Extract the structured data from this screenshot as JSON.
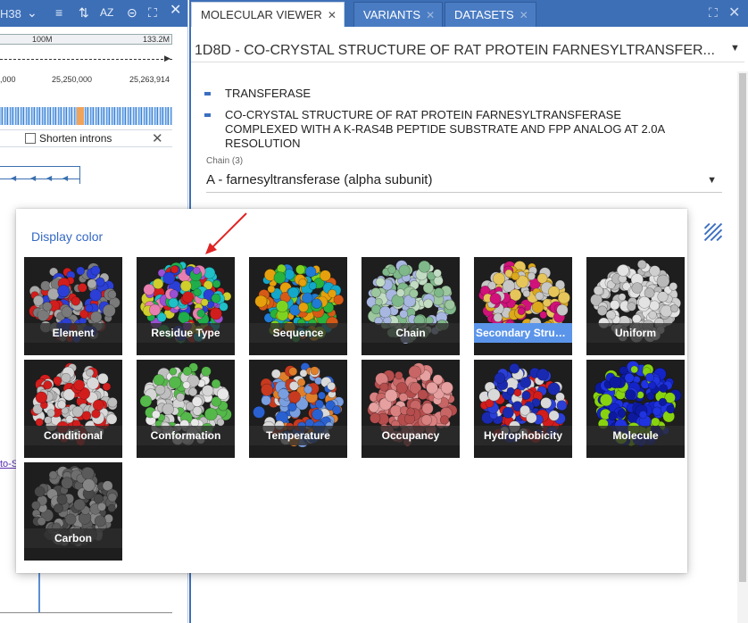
{
  "genome_panel": {
    "build": "H38",
    "ruler_left": "100M",
    "ruler_right": "133.2M",
    "coord_left": ",000",
    "coord_mid": "25,250,000",
    "coord_right": "25,263,914",
    "shorten_introns_label": "Shorten introns",
    "shorten_introns_checked": false,
    "truncated_link": "to-S"
  },
  "tabs": [
    {
      "label": "MOLECULAR VIEWER",
      "active": true
    },
    {
      "label": "VARIANTS",
      "active": false
    },
    {
      "label": "DATASETS",
      "active": false
    }
  ],
  "structure": {
    "title": "1D8D  - CO-CRYSTAL STRUCTURE OF RAT PROTEIN FARNESYLTRANSFER...",
    "keywords": [
      "TRANSFERASE",
      "CO-CRYSTAL STRUCTURE OF RAT PROTEIN FARNESYLTRANSFERASE",
      "COMPLEXED WITH A K-RAS4B PEPTIDE SUBSTRATE AND FPP ANALOG AT 2.0A",
      "RESOLUTION"
    ],
    "chain_label": "Chain (3)",
    "chain_value": "A - farnesyltransferase (alpha subunit)"
  },
  "display_color": {
    "heading": "Display color",
    "selected": "Secondary Structure",
    "options": [
      {
        "label": "Element",
        "palette": [
          "#7a7a7a",
          "#d21d1d",
          "#2b3fd6",
          "#a9a9a9"
        ]
      },
      {
        "label": "Residue Type",
        "palette": [
          "#d0ce2c",
          "#1fae4b",
          "#d21d1d",
          "#2b3fd6",
          "#9b4fd3",
          "#1fc0c8",
          "#e87fb0"
        ]
      },
      {
        "label": "Sequence",
        "palette": [
          "#28b33c",
          "#1f7bd6",
          "#e6a00d",
          "#d65a16",
          "#7ed321",
          "#13a7c9"
        ]
      },
      {
        "label": "Chain",
        "palette": [
          "#9dc79f",
          "#a8b7e0",
          "#7fb88a",
          "#c2dcc3"
        ]
      },
      {
        "label": "Secondary Structure",
        "palette": [
          "#dca81c",
          "#c7c7c7",
          "#d0127a",
          "#e6c55a"
        ]
      },
      {
        "label": "Uniform",
        "palette": [
          "#cfcfcf",
          "#b9b9b9",
          "#e3e3e3"
        ]
      },
      {
        "label": "Conditional",
        "palette": [
          "#d9d9d9",
          "#d21d1d",
          "#bdbdbd"
        ]
      },
      {
        "label": "Conformation",
        "palette": [
          "#d6d6d6",
          "#bfbfbf",
          "#e8e8e8",
          "#55b84a"
        ]
      },
      {
        "label": "Temperature",
        "palette": [
          "#c73a1f",
          "#2a61d1",
          "#e07f2a",
          "#d9d9d9",
          "#7a9fe0"
        ]
      },
      {
        "label": "Occupancy",
        "palette": [
          "#c86565",
          "#d98080",
          "#b54d4d",
          "#e6a0a0"
        ]
      },
      {
        "label": "Hydrophobicity",
        "palette": [
          "#2b3fd6",
          "#d21d1d",
          "#d9d9d9",
          "#1a2ab0"
        ]
      },
      {
        "label": "Molecule",
        "palette": [
          "#1424c9",
          "#1f33e0",
          "#0d1aa0",
          "#88d30f"
        ]
      },
      {
        "label": "Carbon",
        "palette": [
          "#5a5a5a",
          "#6e6e6e",
          "#484848",
          "#858585"
        ]
      }
    ]
  }
}
